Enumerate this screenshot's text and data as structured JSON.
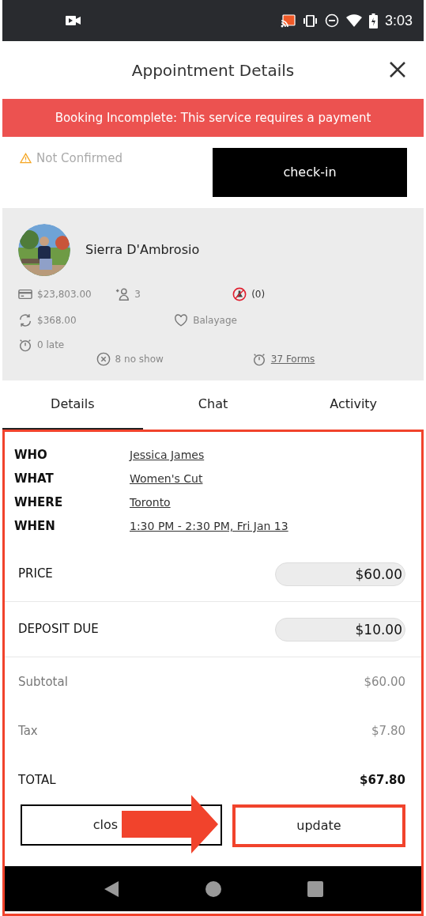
{
  "status_bar": {
    "time": "3:03"
  },
  "header": {
    "title": "Appointment Details"
  },
  "banner": {
    "text": "Booking Incomplete: This service requires a payment"
  },
  "status": {
    "text": "Not Confirmed",
    "checkin_label": "check-in"
  },
  "client": {
    "name": "Sierra D'Ambrosio",
    "stats": [
      [
        {
          "kind": "spent",
          "text": "$23,803.00"
        },
        {
          "kind": "referrals",
          "text": "3"
        },
        {
          "kind": "patch",
          "text": "(0)"
        }
      ],
      [
        {
          "kind": "recurring",
          "text": "$368.00"
        },
        {
          "kind": "favorite",
          "text": "Balayage"
        }
      ],
      [
        {
          "kind": "late",
          "text": "0 late"
        },
        {
          "kind": "noshow",
          "text": "8 no show"
        },
        {
          "kind": "forms",
          "text": "37 Forms"
        }
      ]
    ]
  },
  "tabs": [
    {
      "label": "Details",
      "selected": true
    },
    {
      "label": "Chat",
      "selected": false
    },
    {
      "label": "Activity",
      "selected": false
    }
  ],
  "details": [
    {
      "label": "WHO",
      "value": "Jessica James"
    },
    {
      "label": "WHAT",
      "value": "Women's Cut"
    },
    {
      "label": "WHERE",
      "value": "Toronto"
    },
    {
      "label": "WHEN",
      "value": "1:30 PM - 2:30 PM, Fri Jan 13"
    }
  ],
  "amounts": [
    {
      "label": "PRICE",
      "value": "$60.00"
    },
    {
      "label": "DEPOSIT DUE",
      "value": "$10.00"
    }
  ],
  "summary": [
    {
      "label": "Subtotal",
      "value": "$60.00",
      "kind": "line"
    },
    {
      "label": "Tax",
      "value": "$7.80",
      "kind": "line"
    },
    {
      "label": "TOTAL",
      "value": "$67.80",
      "kind": "total"
    }
  ],
  "buttons": {
    "close": "clos",
    "update": "update"
  }
}
